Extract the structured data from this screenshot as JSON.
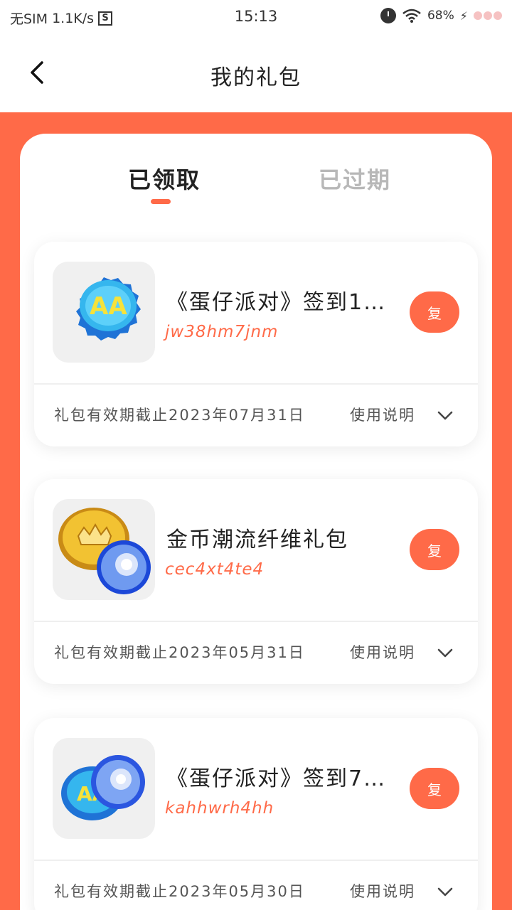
{
  "status_bar": {
    "carrier": "无SIM",
    "speed": "1.1K/s",
    "s_icon": "S",
    "time": "15:13",
    "battery": "68%"
  },
  "header": {
    "title": "我的礼包"
  },
  "tabs": [
    {
      "label": "已领取",
      "active": true
    },
    {
      "label": "已过期",
      "active": false
    }
  ],
  "gifts": [
    {
      "name": "《蛋仔派对》签到1…",
      "code": "jw38hm7jnm",
      "button": "复",
      "expiry": "礼包有效期截止2023年07月31日",
      "usage": "使用说明",
      "icon": "bottle-cap-icon"
    },
    {
      "name": "金币潮流纤维礼包",
      "code": "cec4xt4te4",
      "button": "复",
      "expiry": "礼包有效期截止2023年05月31日",
      "usage": "使用说明",
      "icon": "coin-capsule-icon"
    },
    {
      "name": "《蛋仔派对》签到7…",
      "code": "kahhwrh4hh",
      "button": "复",
      "expiry": "礼包有效期截止2023年05月30日",
      "usage": "使用说明",
      "icon": "cap-capsule-icon"
    }
  ],
  "colors": {
    "accent": "#ff6a48",
    "tab_inactive": "#b8b8b8"
  }
}
